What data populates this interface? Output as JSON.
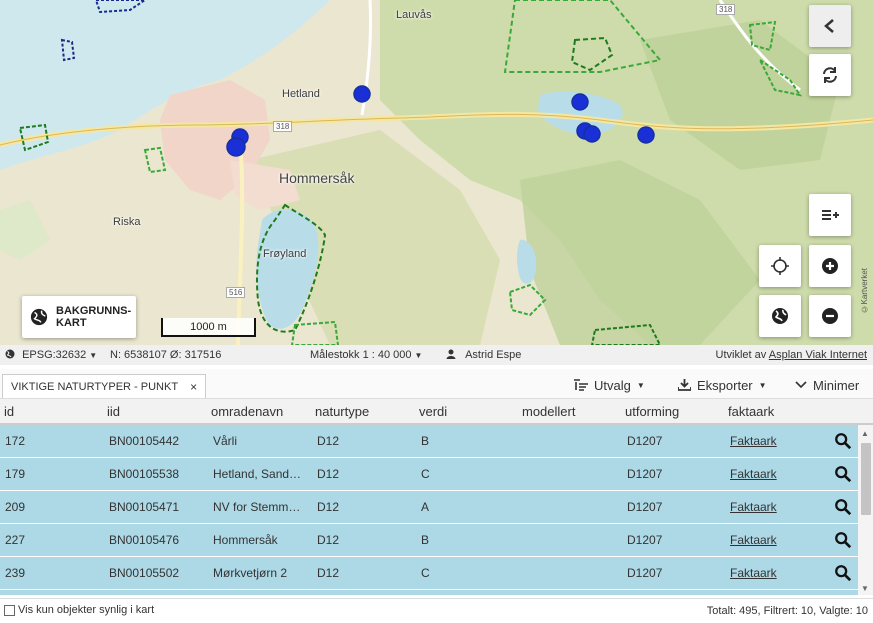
{
  "map": {
    "places": [
      {
        "name": "Lauvås",
        "size": "small"
      },
      {
        "name": "Hetland",
        "size": "small"
      },
      {
        "name": "Hommersåk",
        "size": "big"
      },
      {
        "name": "Riska",
        "size": "small"
      },
      {
        "name": "Frøyland",
        "size": "small"
      }
    ],
    "road_numbers": [
      "318",
      "318",
      "516"
    ],
    "scale_label": "1000 m",
    "background_button_label": "BAKGRUNNS-\nKART",
    "attribution": "©Kartverket",
    "marker_color": "#1a2fd6",
    "polygon_color": "#1e8a1e",
    "buttons": [
      "share-icon",
      "refresh-icon",
      "add-layer-icon",
      "locate-icon",
      "zoom-in-icon",
      "globe-icon",
      "zoom-out-icon"
    ]
  },
  "statusbar": {
    "projection": "EPSG:32632",
    "coords": "N: 6538107 Ø: 317516",
    "scale": "Målestokk 1 : 40 000",
    "user": "Astrid Espe",
    "credit_prefix": "Utviklet av",
    "credit_link": "Asplan Viak Internet"
  },
  "panel": {
    "tab_title": "VIKTIGE NATURTYPER - PUNKT",
    "tab_close": "×",
    "selection_label": "Utvalg",
    "export_label": "Eksporter",
    "minimize_label": "Minimer"
  },
  "table": {
    "columns": [
      "id",
      "iid",
      "omradenavn",
      "naturtype",
      "verdi",
      "modellert",
      "utforming",
      "faktaark"
    ],
    "rows": [
      {
        "id": "172",
        "iid": "BN00105442",
        "omradenavn": "Vårli",
        "naturtype": "D12",
        "verdi": "B",
        "modellert": "",
        "utforming": "D1207",
        "faktaark": "Faktaark"
      },
      {
        "id": "179",
        "iid": "BN00105538",
        "omradenavn": "Hetland, Sand…",
        "naturtype": "D12",
        "verdi": "C",
        "modellert": "",
        "utforming": "D1207",
        "faktaark": "Faktaark"
      },
      {
        "id": "209",
        "iid": "BN00105471",
        "omradenavn": "NV for Stemm…",
        "naturtype": "D12",
        "verdi": "A",
        "modellert": "",
        "utforming": "D1207",
        "faktaark": "Faktaark"
      },
      {
        "id": "227",
        "iid": "BN00105476",
        "omradenavn": "Hommersåk",
        "naturtype": "D12",
        "verdi": "B",
        "modellert": "",
        "utforming": "D1207",
        "faktaark": "Faktaark"
      },
      {
        "id": "239",
        "iid": "BN00105502",
        "omradenavn": "Mørkvetjørn 2",
        "naturtype": "D12",
        "verdi": "C",
        "modellert": "",
        "utforming": "D1207",
        "faktaark": "Faktaark"
      }
    ]
  },
  "footer": {
    "visible_only_label": "Vis kun objekter synlig i kart",
    "totals": "Totalt: 495, Filtrert: 10, Valgte: 10"
  }
}
